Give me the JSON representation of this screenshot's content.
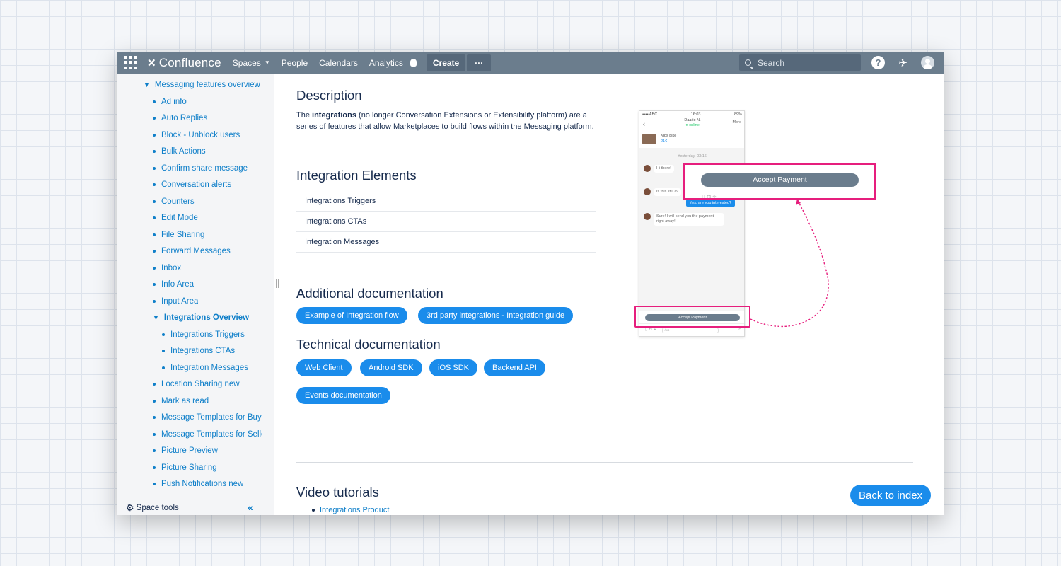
{
  "nav": {
    "logo": "Confluence",
    "items": [
      "Spaces",
      "People",
      "Calendars",
      "Analytics"
    ],
    "create": "Create",
    "more": "···",
    "search_placeholder": "Search",
    "help": "?"
  },
  "sidebar": {
    "items": [
      {
        "label": "Messaging features overview",
        "level": 0,
        "expanded": true
      },
      {
        "label": "Ad info",
        "level": 1
      },
      {
        "label": "Auto Replies",
        "level": 1
      },
      {
        "label": "Block - Unblock users",
        "level": 1
      },
      {
        "label": "Bulk Actions",
        "level": 1
      },
      {
        "label": "Confirm share message",
        "level": 1
      },
      {
        "label": "Conversation alerts",
        "level": 1
      },
      {
        "label": "Counters",
        "level": 1
      },
      {
        "label": "Edit Mode",
        "level": 1
      },
      {
        "label": "File Sharing",
        "level": 1
      },
      {
        "label": "Forward Messages",
        "level": 1
      },
      {
        "label": "Inbox",
        "level": 1
      },
      {
        "label": "Info Area",
        "level": 1
      },
      {
        "label": "Input Area",
        "level": 1
      },
      {
        "label": "Integrations Overview",
        "level": 1,
        "expanded": true,
        "active": true
      },
      {
        "label": "Integrations Triggers",
        "level": 2
      },
      {
        "label": "Integrations CTAs",
        "level": 2
      },
      {
        "label": "Integration Messages",
        "level": 2
      },
      {
        "label": "Location Sharing new",
        "level": 1
      },
      {
        "label": "Mark as read",
        "level": 1
      },
      {
        "label": "Message Templates for Buyers",
        "level": 1
      },
      {
        "label": "Message Templates for Sellers",
        "level": 1
      },
      {
        "label": "Picture Preview",
        "level": 1
      },
      {
        "label": "Picture Sharing",
        "level": 1
      },
      {
        "label": "Push Notifications new",
        "level": 1
      }
    ],
    "space_tools": "Space tools",
    "collapse": "«"
  },
  "content": {
    "description_title": "Description",
    "description_pre": "The ",
    "description_bold": "integrations",
    "description_post": " (no longer Conversation Extensions or Extensibility platform) are a series of features that allow Marketplaces to build flows within the Messaging platform.",
    "elements_title": "Integration Elements",
    "elements": [
      "Integrations Triggers",
      "Integrations CTAs",
      "Integration Messages"
    ],
    "additional_title": "Additional documentation",
    "additional_links": [
      "Example of Integration flow",
      "3rd party integrations - Integration guide"
    ],
    "technical_title": "Technical documentation",
    "technical_links": [
      "Web Client",
      "Android SDK",
      "iOS SDK",
      "Backend API",
      "Events documentation"
    ],
    "video_title": "Video tutorials",
    "video_links": [
      "Integrations Product"
    ],
    "back_button": "Back to index"
  },
  "mockup": {
    "carrier": "••••• ABC",
    "time": "16:03",
    "battery": "89%",
    "contact": "Daario N.",
    "status": "● online",
    "more": "More",
    "item_title": "Kids bike",
    "item_price": "21€",
    "date": "Yesterday, 03:16",
    "msg1": "Hi there!",
    "msg2": "Is this still av",
    "reply": "Yes, are you interested?",
    "msg3": "Sure! I will send you the payment right away!",
    "accept_small": "Accept Payment",
    "accept_zoom": "Accept Payment",
    "input_placeholder": "Aa",
    "colors": {
      "highlight": "#e61e7d",
      "button": "#6b7d8d",
      "accent": "#1a8ceb"
    }
  }
}
